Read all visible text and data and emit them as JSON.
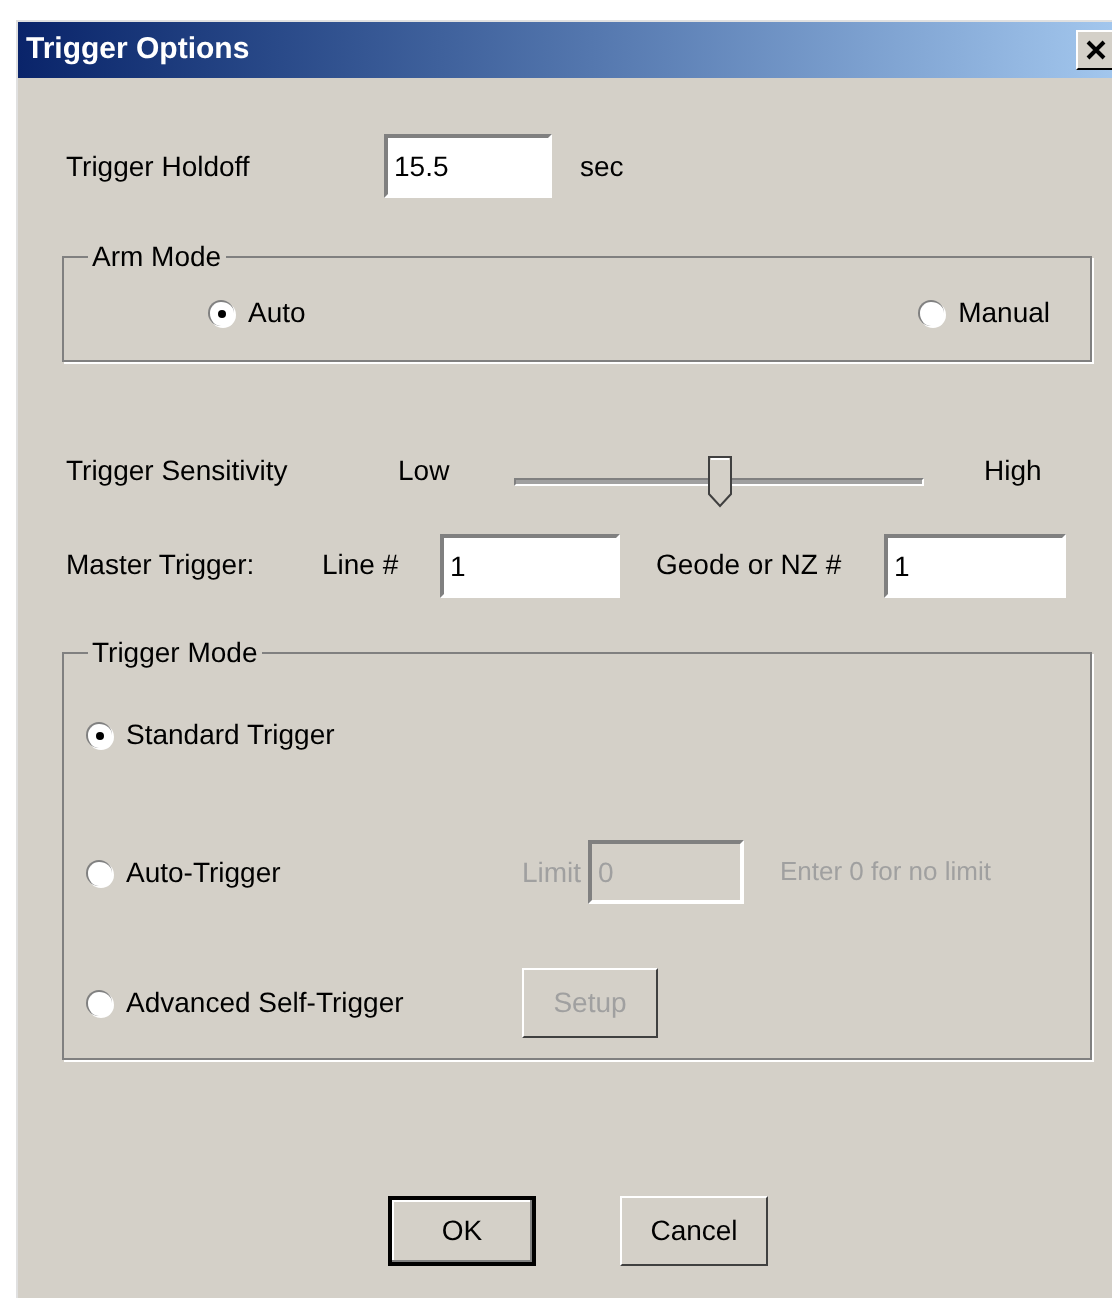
{
  "window": {
    "title": "Trigger Options"
  },
  "holdoff": {
    "label": "Trigger Holdoff",
    "value": "15.5",
    "unit": "sec"
  },
  "arm_mode": {
    "title": "Arm Mode",
    "options": [
      {
        "label": "Auto",
        "selected": true
      },
      {
        "label": "Manual",
        "selected": false
      }
    ]
  },
  "sensitivity": {
    "label": "Trigger Sensitivity",
    "low": "Low",
    "high": "High",
    "level": 0.5
  },
  "master_trigger": {
    "label": "Master Trigger:",
    "line_label": "Line #",
    "line_value": "1",
    "geode_label": "Geode or NZ #",
    "geode_value": "1"
  },
  "trigger_mode": {
    "title": "Trigger Mode",
    "options": [
      {
        "kind": "plain",
        "label": "Standard Trigger",
        "selected": true
      },
      {
        "kind": "limit",
        "label": "Auto-Trigger",
        "selected": false,
        "limit_label": "Limit",
        "limit_value": "0",
        "hint": "Enter 0 for no limit",
        "disabled": true
      },
      {
        "kind": "setup",
        "label": "Advanced Self-Trigger",
        "selected": false,
        "button": "Setup",
        "disabled": true
      }
    ]
  },
  "buttons": [
    {
      "label": "OK",
      "default": true
    },
    {
      "label": "Cancel",
      "default": false
    }
  ]
}
